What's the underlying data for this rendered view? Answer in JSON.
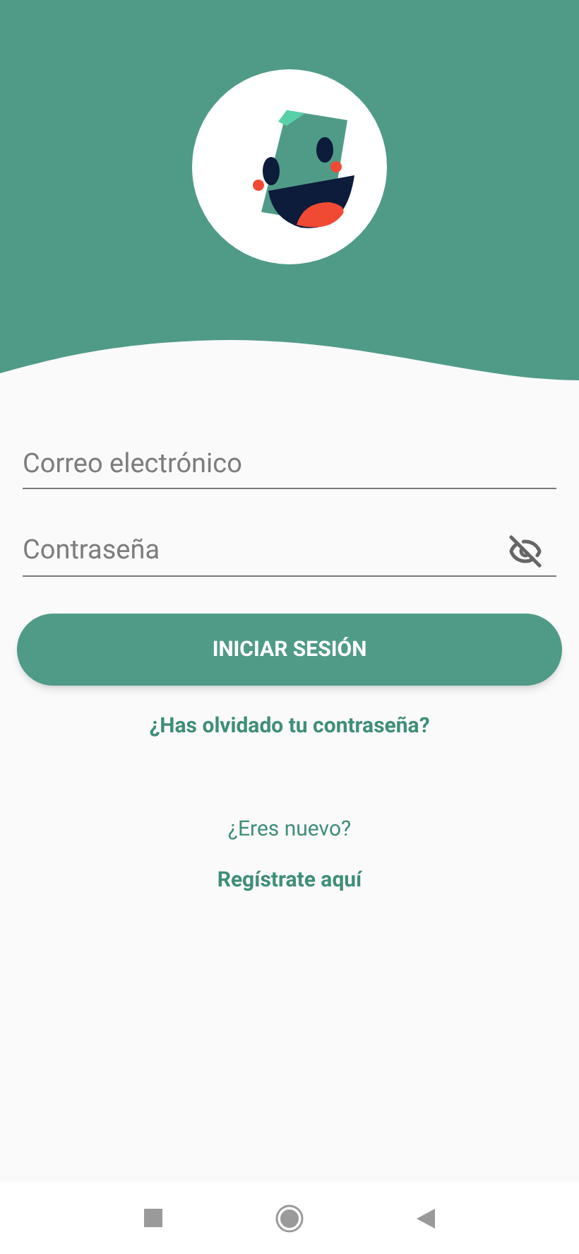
{
  "email_field": {
    "placeholder": "Correo electrónico"
  },
  "password_field": {
    "placeholder": "Contraseña",
    "password_visible": false
  },
  "login_button": {
    "label": "INICIAR SESIÓN"
  },
  "forgot_password_link": "¿Has olvidado tu contraseña?",
  "new_user_text": "¿Eres nuevo?",
  "register_link": "Regístrate aquí"
}
